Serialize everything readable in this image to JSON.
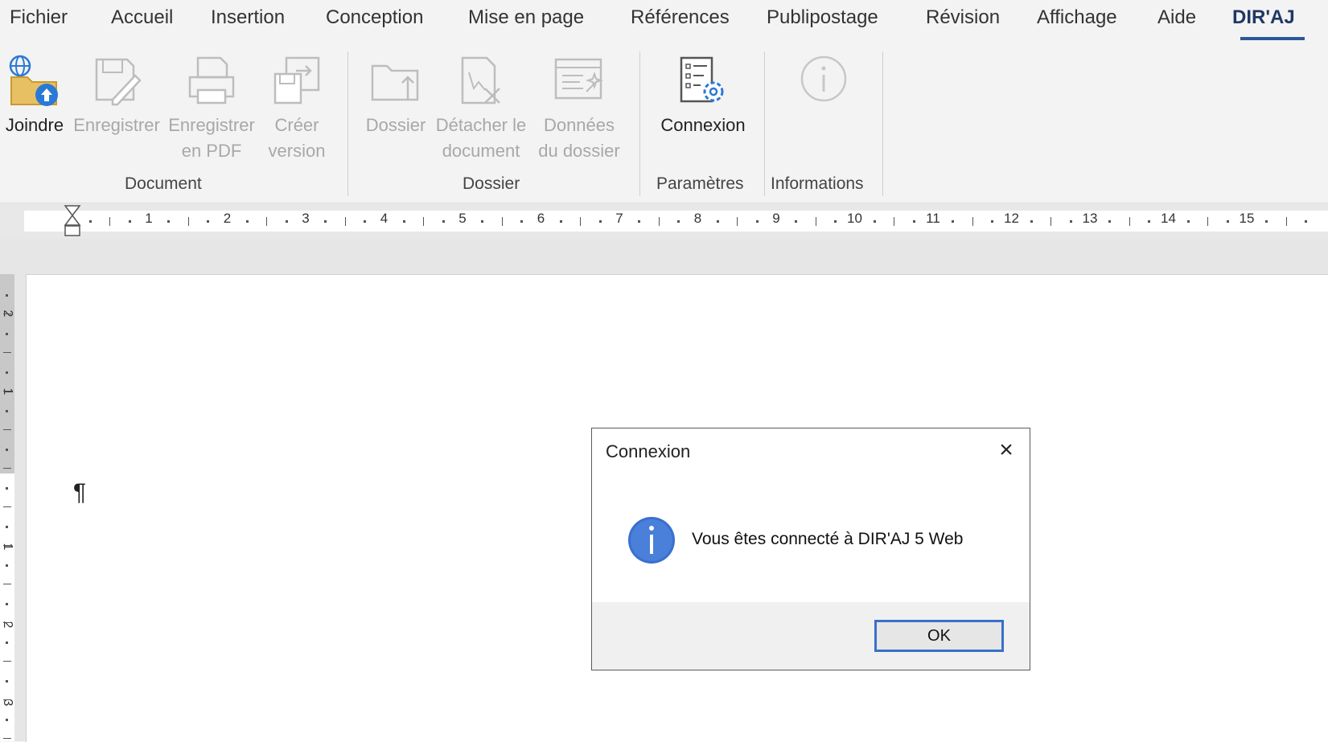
{
  "tabs": [
    "Fichier",
    "Accueil",
    "Insertion",
    "Conception",
    "Mise en page",
    "Références",
    "Publipostage",
    "Révision",
    "Affichage",
    "Aide",
    "DIR'AJ"
  ],
  "active_tab": "DIR'AJ",
  "ribbon": {
    "groups": {
      "document": "Document",
      "dossier": "Dossier",
      "parametres": "Paramètres",
      "informations": "Informations"
    },
    "buttons": {
      "joindre": "Joindre",
      "enregistrer": "Enregistrer",
      "enregistrer_pdf_1": "Enregistrer",
      "enregistrer_pdf_2": "en PDF",
      "creer_version_1": "Créer",
      "creer_version_2": "version",
      "dossier": "Dossier",
      "detacher_1": "Détacher le",
      "detacher_2": "document",
      "donnees_1": "Données",
      "donnees_2": "du dossier",
      "connexion": "Connexion"
    }
  },
  "ruler": {
    "numbers": [
      "1",
      "2",
      "3",
      "4",
      "5",
      "6",
      "7",
      "8",
      "9",
      "10",
      "11",
      "12",
      "13",
      "14",
      "15"
    ],
    "vertical_numbers": [
      "2",
      "1",
      "1",
      "2",
      "3"
    ]
  },
  "document": {
    "pilcrow": "¶"
  },
  "dialog": {
    "title": "Connexion",
    "close": "×",
    "message": "Vous êtes connecté à DIR'AJ 5 Web",
    "ok": "OK"
  },
  "colors": {
    "accent": "#2b579a",
    "info_icon": "#3a6fcf",
    "disabled": "#a8a8a8"
  }
}
